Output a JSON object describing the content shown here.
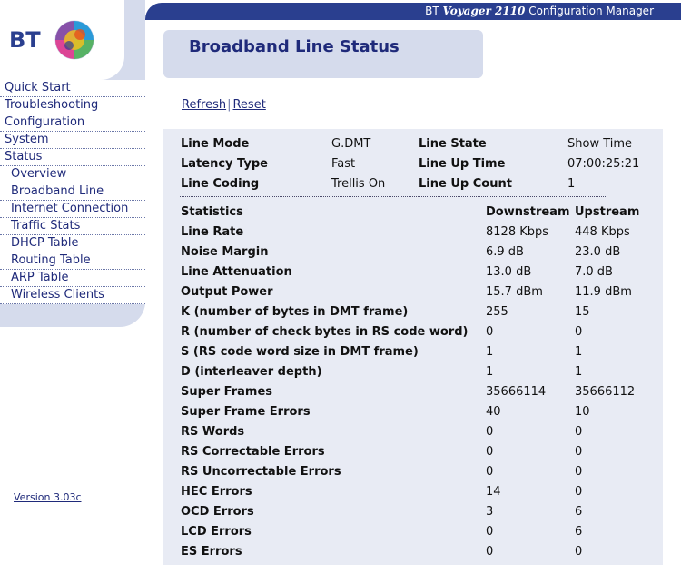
{
  "header": {
    "brand_prefix": "BT ",
    "product": "Voyager 2110",
    "suffix": " Configuration Manager"
  },
  "logo": {
    "text": "BT"
  },
  "sidebar": {
    "items": [
      {
        "label": "Quick Start",
        "sub": false
      },
      {
        "label": "Troubleshooting",
        "sub": false
      },
      {
        "label": "Configuration",
        "sub": false
      },
      {
        "label": "System",
        "sub": false
      },
      {
        "label": "Status",
        "sub": false
      },
      {
        "label": "Overview",
        "sub": true
      },
      {
        "label": "Broadband Line",
        "sub": true
      },
      {
        "label": "Internet Connection",
        "sub": true
      },
      {
        "label": "Traffic Stats",
        "sub": true
      },
      {
        "label": "DHCP Table",
        "sub": true
      },
      {
        "label": "Routing Table",
        "sub": true
      },
      {
        "label": "ARP Table",
        "sub": true
      },
      {
        "label": "Wireless Clients",
        "sub": true
      }
    ],
    "version": "Version 3.03c"
  },
  "page": {
    "title": "Broadband Line Status",
    "refresh": "Refresh",
    "reset": "Reset"
  },
  "line": {
    "mode_label": "Line Mode",
    "mode": "G.DMT",
    "state_label": "Line State",
    "state": "Show Time",
    "latency_label": "Latency Type",
    "latency": "Fast",
    "uptime_label": "Line Up Time",
    "uptime": "07:00:25:21",
    "coding_label": "Line Coding",
    "coding": "Trellis On",
    "upcount_label": "Line Up Count",
    "upcount": "1"
  },
  "stats": {
    "header": "Statistics",
    "downstream": "Downstream",
    "upstream": "Upstream",
    "rows": [
      {
        "label": "Line Rate",
        "down": "8128 Kbps",
        "up": "448 Kbps"
      },
      {
        "label": "Noise Margin",
        "down": "6.9 dB",
        "up": "23.0 dB"
      },
      {
        "label": "Line Attenuation",
        "down": "13.0 dB",
        "up": "7.0 dB"
      },
      {
        "label": "Output Power",
        "down": "15.7 dBm",
        "up": "11.9 dBm"
      },
      {
        "label": "K (number of bytes in DMT frame)",
        "down": "255",
        "up": "15"
      },
      {
        "label": "R (number of check bytes in RS code word)",
        "down": "0",
        "up": "0"
      },
      {
        "label": "S (RS code word size in DMT frame)",
        "down": "1",
        "up": "1"
      },
      {
        "label": "D (interleaver depth)",
        "down": "1",
        "up": "1"
      },
      {
        "label": "Super Frames",
        "down": "35666114",
        "up": "35666112"
      },
      {
        "label": "Super Frame Errors",
        "down": "40",
        "up": "10"
      },
      {
        "label": "RS Words",
        "down": "0",
        "up": "0"
      },
      {
        "label": "RS Correctable Errors",
        "down": "0",
        "up": "0"
      },
      {
        "label": "RS Uncorrectable Errors",
        "down": "0",
        "up": "0"
      },
      {
        "label": "HEC Errors",
        "down": "14",
        "up": "0"
      },
      {
        "label": "OCD Errors",
        "down": "3",
        "up": "6"
      },
      {
        "label": "LCD Errors",
        "down": "0",
        "up": "6"
      },
      {
        "label": "ES Errors",
        "down": "0",
        "up": "0"
      }
    ]
  }
}
